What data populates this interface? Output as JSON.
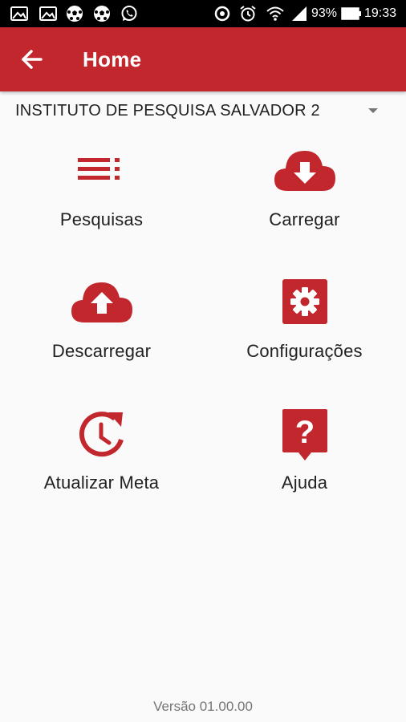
{
  "status_bar": {
    "battery": "93%",
    "time": "19:33"
  },
  "app_bar": {
    "title": "Home"
  },
  "spinner": {
    "selected": "INSTITUTO DE PESQUISA SALVADOR 2"
  },
  "menu": {
    "items": [
      {
        "label": "Pesquisas",
        "icon": "list-icon"
      },
      {
        "label": "Carregar",
        "icon": "cloud-download-icon"
      },
      {
        "label": "Descarregar",
        "icon": "cloud-upload-icon"
      },
      {
        "label": "Configurações",
        "icon": "settings-icon"
      },
      {
        "label": "Atualizar Meta",
        "icon": "history-refresh-icon"
      },
      {
        "label": "Ajuda",
        "icon": "help-icon"
      }
    ]
  },
  "footer": {
    "version": "Versão 01.00.00"
  },
  "colors": {
    "accent": "#c1272d",
    "status_bar": "#000000",
    "background": "#fafafa"
  }
}
